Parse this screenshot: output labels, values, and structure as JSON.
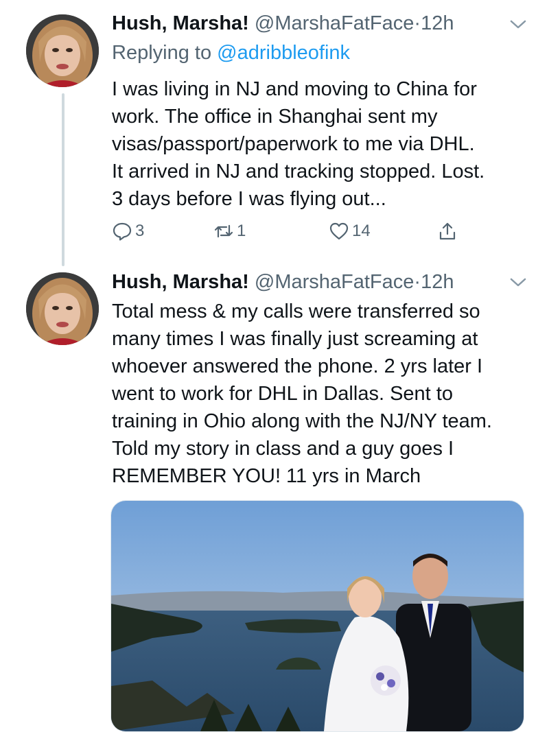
{
  "tweets": [
    {
      "name": "Hush, Marsha!",
      "handle": "@MarshaFatFace",
      "dot": "·",
      "time": "12h",
      "replying_prefix": "Replying to",
      "replying_to": "@adribbleofink",
      "text_lines": [
        "I was living in NJ and moving to China for",
        "work. The office in Shanghai sent my",
        "visas/passport/paperwork to me via DHL.",
        "It arrived in NJ and tracking stopped. Lost.",
        "3 days before I was flying out..."
      ],
      "actions": {
        "replies": "3",
        "retweets": "1",
        "likes": "14",
        "reply_icon": "reply-icon",
        "retweet_icon": "retweet-icon",
        "like_icon": "heart-icon",
        "share_icon": "share-icon"
      }
    },
    {
      "name": "Hush, Marsha!",
      "handle": "@MarshaFatFace",
      "dot": "·",
      "time": "12h",
      "text_lines": [
        "Total mess & my calls were transferred so",
        "many times I was finally just screaming at",
        "whoever answered the phone. 2 yrs later I",
        "went to work for DHL in Dallas. Sent to",
        "training in Ohio along with the NJ/NY team.",
        "Told my story in class and a guy goes I",
        "REMEMBER YOU! 11 yrs in March"
      ],
      "media": "photo"
    }
  ],
  "colors": {
    "accent": "#1d9bf0",
    "secondary_text": "#536471",
    "thread_line": "#cfd9de"
  }
}
